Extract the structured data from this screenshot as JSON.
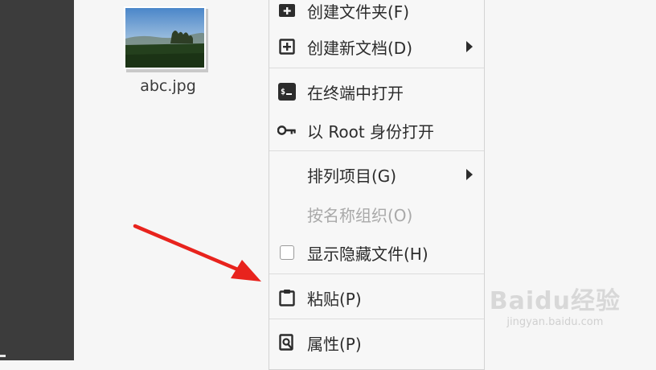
{
  "desktop": {
    "file": {
      "name": "abc.jpg",
      "icon": "image-thumbnail-icon"
    }
  },
  "context_menu": {
    "items": [
      {
        "label": "创建文件夹(F)",
        "icon": "new-folder-icon",
        "submenu": false,
        "enabled": true
      },
      {
        "label": "创建新文档(D)",
        "icon": "new-document-icon",
        "submenu": true,
        "enabled": true
      },
      {
        "label": "在终端中打开",
        "icon": "terminal-icon",
        "submenu": false,
        "enabled": true
      },
      {
        "label": "以 Root 身份打开",
        "icon": "key-icon",
        "submenu": false,
        "enabled": true
      },
      {
        "label": "排列项目(G)",
        "icon": "",
        "submenu": true,
        "enabled": true
      },
      {
        "label": "按名称组织(O)",
        "icon": "",
        "submenu": false,
        "enabled": false
      },
      {
        "label": "显示隐藏文件(H)",
        "icon": "checkbox-icon",
        "submenu": false,
        "enabled": true,
        "checked": false
      },
      {
        "label": "粘贴(P)",
        "icon": "clipboard-icon",
        "submenu": false,
        "enabled": true
      },
      {
        "label": "属性(P)",
        "icon": "properties-icon",
        "submenu": false,
        "enabled": true
      }
    ]
  },
  "annotation": {
    "arrow_color": "#e8231d"
  },
  "watermark": {
    "logo": "Baidu经验",
    "url": "jingyan.baidu.com"
  }
}
